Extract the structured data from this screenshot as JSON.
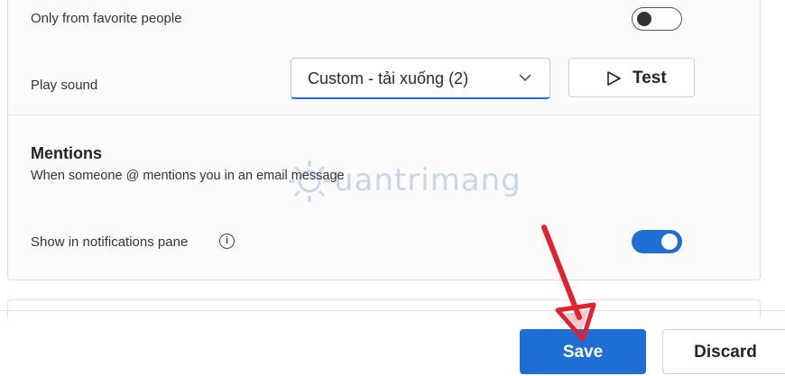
{
  "favorites": {
    "label": "Only from favorite people",
    "toggle_on": false
  },
  "sound": {
    "label": "Play sound",
    "selected": "Custom - tải xuống (2)",
    "test_label": "Test"
  },
  "mentions": {
    "heading": "Mentions",
    "description": "When someone @ mentions you in an email message",
    "show_label": "Show in notifications pane",
    "info_glyph": "i",
    "toggle_on": true
  },
  "footer": {
    "save_label": "Save",
    "discard_label": "Discard"
  },
  "watermark": {
    "text": "uantrimang"
  },
  "colors": {
    "accent": "#1f6ed4",
    "annotation_arrow": "#e0232e"
  },
  "icons": [
    "play-outline-icon",
    "chevron-down-icon",
    "info-icon"
  ]
}
